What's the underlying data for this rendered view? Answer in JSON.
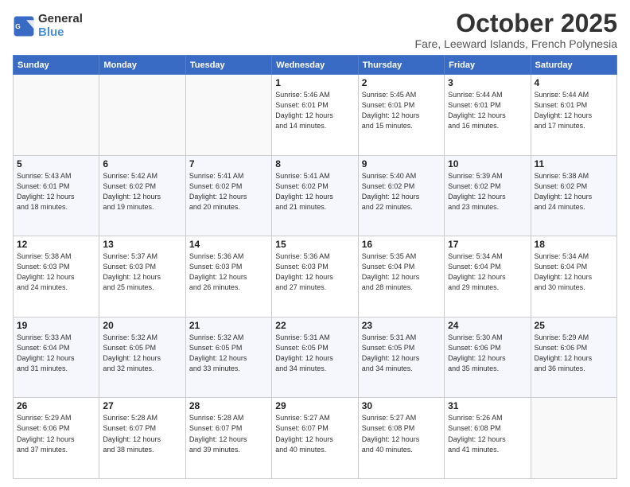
{
  "header": {
    "logo_line1": "General",
    "logo_line2": "Blue",
    "month": "October 2025",
    "location": "Fare, Leeward Islands, French Polynesia"
  },
  "weekdays": [
    "Sunday",
    "Monday",
    "Tuesday",
    "Wednesday",
    "Thursday",
    "Friday",
    "Saturday"
  ],
  "weeks": [
    [
      {
        "day": "",
        "info": ""
      },
      {
        "day": "",
        "info": ""
      },
      {
        "day": "",
        "info": ""
      },
      {
        "day": "1",
        "info": "Sunrise: 5:46 AM\nSunset: 6:01 PM\nDaylight: 12 hours\nand 14 minutes."
      },
      {
        "day": "2",
        "info": "Sunrise: 5:45 AM\nSunset: 6:01 PM\nDaylight: 12 hours\nand 15 minutes."
      },
      {
        "day": "3",
        "info": "Sunrise: 5:44 AM\nSunset: 6:01 PM\nDaylight: 12 hours\nand 16 minutes."
      },
      {
        "day": "4",
        "info": "Sunrise: 5:44 AM\nSunset: 6:01 PM\nDaylight: 12 hours\nand 17 minutes."
      }
    ],
    [
      {
        "day": "5",
        "info": "Sunrise: 5:43 AM\nSunset: 6:01 PM\nDaylight: 12 hours\nand 18 minutes."
      },
      {
        "day": "6",
        "info": "Sunrise: 5:42 AM\nSunset: 6:02 PM\nDaylight: 12 hours\nand 19 minutes."
      },
      {
        "day": "7",
        "info": "Sunrise: 5:41 AM\nSunset: 6:02 PM\nDaylight: 12 hours\nand 20 minutes."
      },
      {
        "day": "8",
        "info": "Sunrise: 5:41 AM\nSunset: 6:02 PM\nDaylight: 12 hours\nand 21 minutes."
      },
      {
        "day": "9",
        "info": "Sunrise: 5:40 AM\nSunset: 6:02 PM\nDaylight: 12 hours\nand 22 minutes."
      },
      {
        "day": "10",
        "info": "Sunrise: 5:39 AM\nSunset: 6:02 PM\nDaylight: 12 hours\nand 23 minutes."
      },
      {
        "day": "11",
        "info": "Sunrise: 5:38 AM\nSunset: 6:02 PM\nDaylight: 12 hours\nand 24 minutes."
      }
    ],
    [
      {
        "day": "12",
        "info": "Sunrise: 5:38 AM\nSunset: 6:03 PM\nDaylight: 12 hours\nand 24 minutes."
      },
      {
        "day": "13",
        "info": "Sunrise: 5:37 AM\nSunset: 6:03 PM\nDaylight: 12 hours\nand 25 minutes."
      },
      {
        "day": "14",
        "info": "Sunrise: 5:36 AM\nSunset: 6:03 PM\nDaylight: 12 hours\nand 26 minutes."
      },
      {
        "day": "15",
        "info": "Sunrise: 5:36 AM\nSunset: 6:03 PM\nDaylight: 12 hours\nand 27 minutes."
      },
      {
        "day": "16",
        "info": "Sunrise: 5:35 AM\nSunset: 6:04 PM\nDaylight: 12 hours\nand 28 minutes."
      },
      {
        "day": "17",
        "info": "Sunrise: 5:34 AM\nSunset: 6:04 PM\nDaylight: 12 hours\nand 29 minutes."
      },
      {
        "day": "18",
        "info": "Sunrise: 5:34 AM\nSunset: 6:04 PM\nDaylight: 12 hours\nand 30 minutes."
      }
    ],
    [
      {
        "day": "19",
        "info": "Sunrise: 5:33 AM\nSunset: 6:04 PM\nDaylight: 12 hours\nand 31 minutes."
      },
      {
        "day": "20",
        "info": "Sunrise: 5:32 AM\nSunset: 6:05 PM\nDaylight: 12 hours\nand 32 minutes."
      },
      {
        "day": "21",
        "info": "Sunrise: 5:32 AM\nSunset: 6:05 PM\nDaylight: 12 hours\nand 33 minutes."
      },
      {
        "day": "22",
        "info": "Sunrise: 5:31 AM\nSunset: 6:05 PM\nDaylight: 12 hours\nand 34 minutes."
      },
      {
        "day": "23",
        "info": "Sunrise: 5:31 AM\nSunset: 6:05 PM\nDaylight: 12 hours\nand 34 minutes."
      },
      {
        "day": "24",
        "info": "Sunrise: 5:30 AM\nSunset: 6:06 PM\nDaylight: 12 hours\nand 35 minutes."
      },
      {
        "day": "25",
        "info": "Sunrise: 5:29 AM\nSunset: 6:06 PM\nDaylight: 12 hours\nand 36 minutes."
      }
    ],
    [
      {
        "day": "26",
        "info": "Sunrise: 5:29 AM\nSunset: 6:06 PM\nDaylight: 12 hours\nand 37 minutes."
      },
      {
        "day": "27",
        "info": "Sunrise: 5:28 AM\nSunset: 6:07 PM\nDaylight: 12 hours\nand 38 minutes."
      },
      {
        "day": "28",
        "info": "Sunrise: 5:28 AM\nSunset: 6:07 PM\nDaylight: 12 hours\nand 39 minutes."
      },
      {
        "day": "29",
        "info": "Sunrise: 5:27 AM\nSunset: 6:07 PM\nDaylight: 12 hours\nand 40 minutes."
      },
      {
        "day": "30",
        "info": "Sunrise: 5:27 AM\nSunset: 6:08 PM\nDaylight: 12 hours\nand 40 minutes."
      },
      {
        "day": "31",
        "info": "Sunrise: 5:26 AM\nSunset: 6:08 PM\nDaylight: 12 hours\nand 41 minutes."
      },
      {
        "day": "",
        "info": ""
      }
    ]
  ]
}
